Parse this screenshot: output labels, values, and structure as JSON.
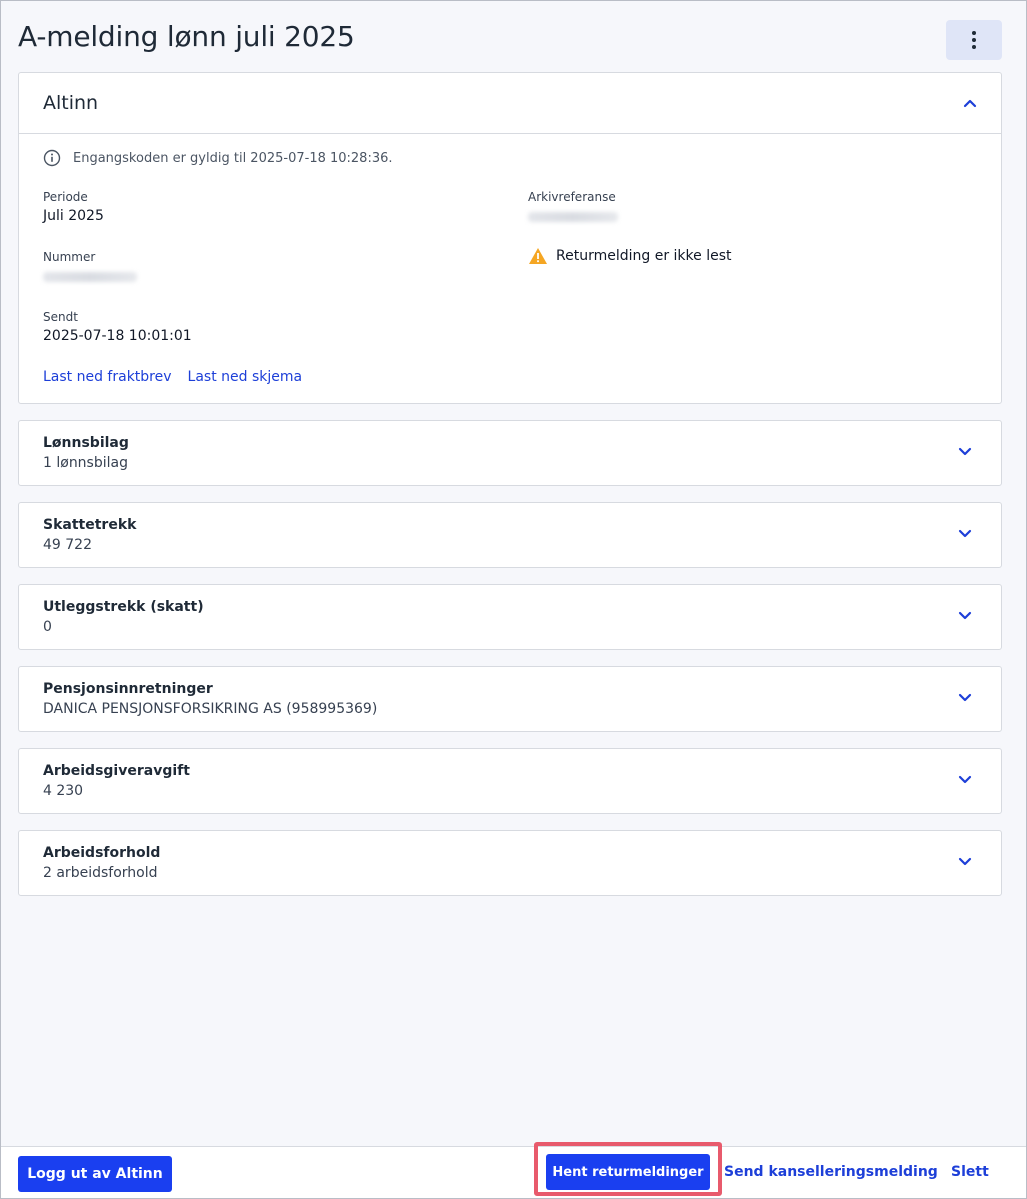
{
  "header": {
    "title": "A-melding lønn juli 2025",
    "menu_icon": "more-vertical-icon"
  },
  "altinn": {
    "title": "Altinn",
    "info_text": "Engangskoden er gyldig til 2025-07-18 10:28:36.",
    "periode_label": "Periode",
    "periode_value": "Juli 2025",
    "arkiv_label": "Arkivreferanse",
    "nummer_label": "Nummer",
    "sendt_label": "Sendt",
    "sendt_value": "2025-07-18 10:01:01",
    "warning_text": "Returmelding er ikke lest",
    "link_fraktbrev": "Last ned fraktbrev",
    "link_skjema": "Last ned skjema"
  },
  "sections": [
    {
      "title": "Lønnsbilag",
      "value": "1 lønnsbilag"
    },
    {
      "title": "Skattetrekk",
      "value": "49 722"
    },
    {
      "title": "Utleggstrekk (skatt)",
      "value": "0"
    },
    {
      "title": "Pensjonsinnretninger",
      "value": "DANICA PENSJONSFORSIKRING AS (958995369)"
    },
    {
      "title": "Arbeidsgiveravgift",
      "value": "4 230"
    },
    {
      "title": "Arbeidsforhold",
      "value": "2 arbeidsforhold"
    }
  ],
  "footer": {
    "logout": "Logg ut av Altinn",
    "hent": "Hent returmeldinger",
    "kansel": "Send kanselleringsmelding",
    "slett": "Slett"
  },
  "colors": {
    "primary": "#1a3ff0",
    "link": "#1d3fd8",
    "warning": "#f5a623",
    "highlight": "#e85a6c"
  }
}
